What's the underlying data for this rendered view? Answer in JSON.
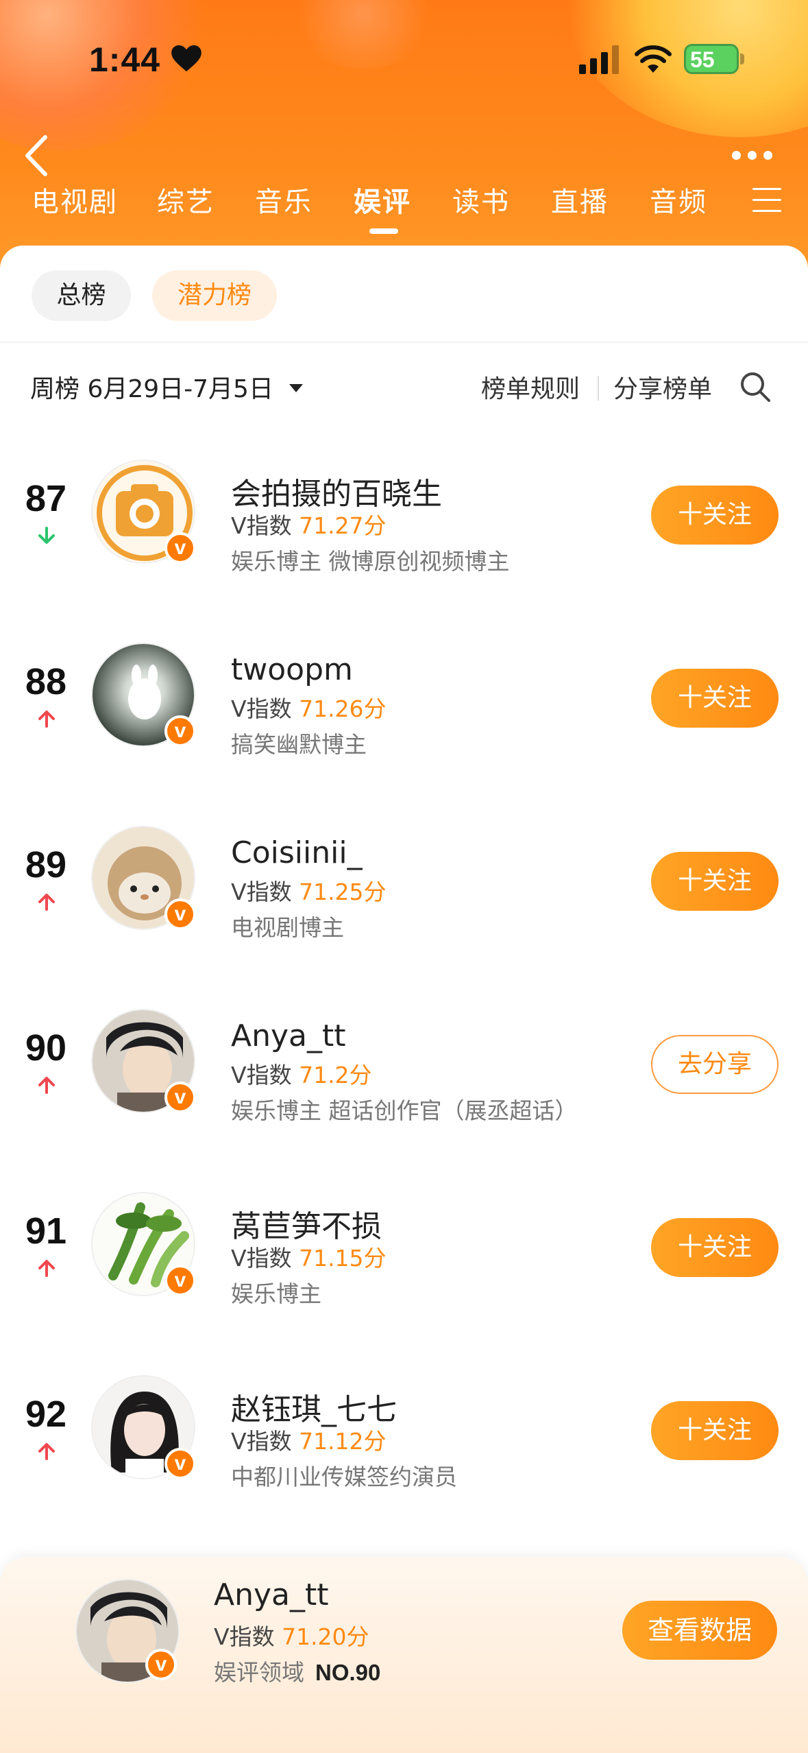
{
  "status_bar": {
    "time": "1:44",
    "battery": "55"
  },
  "nav": {
    "tabs": [
      {
        "label": "电视剧"
      },
      {
        "label": "综艺"
      },
      {
        "label": "音乐"
      },
      {
        "label": "娱评",
        "active": true
      },
      {
        "label": "读书"
      },
      {
        "label": "直播"
      },
      {
        "label": "音频"
      }
    ]
  },
  "sub_tabs": {
    "total": "总榜",
    "potential": "潜力榜"
  },
  "filter": {
    "week_label": "周榜 6月29日-7月5日",
    "rules": "榜单规则",
    "share_list": "分享榜单"
  },
  "rows": [
    {
      "rank": "87",
      "trend": "down",
      "name": "会拍摄的百晓生",
      "score_prefix": "V指数",
      "score": "71.27分",
      "desc": "娱乐博主 微博原创视频博主",
      "action": "十关注",
      "action_type": "follow"
    },
    {
      "rank": "88",
      "trend": "up",
      "name": "twoopm",
      "score_prefix": "V指数",
      "score": "71.26分",
      "desc": "搞笑幽默博主",
      "action": "十关注",
      "action_type": "follow"
    },
    {
      "rank": "89",
      "trend": "up",
      "name": "Coisiinii_",
      "score_prefix": "V指数",
      "score": "71.25分",
      "desc": "电视剧博主",
      "action": "十关注",
      "action_type": "follow"
    },
    {
      "rank": "90",
      "trend": "up",
      "name": "Anya_tt",
      "score_prefix": "V指数",
      "score": "71.2分",
      "desc": "娱乐博主 超话创作官（展丞超话）",
      "action": "去分享",
      "action_type": "share"
    },
    {
      "rank": "91",
      "trend": "up",
      "name": "莴苣笋不损",
      "score_prefix": "V指数",
      "score": "71.15分",
      "desc": "娱乐博主",
      "action": "十关注",
      "action_type": "follow"
    },
    {
      "rank": "92",
      "trend": "up",
      "name": "赵钰琪_七七",
      "score_prefix": "V指数",
      "score": "71.12分",
      "desc": "中都川业传媒签约演员",
      "action": "十关注",
      "action_type": "follow"
    }
  ],
  "me": {
    "name": "Anya_tt",
    "score_prefix": "V指数",
    "score": "71.20分",
    "domain_label": "娱评领域",
    "rank": "NO.90",
    "button": "查看数据"
  },
  "colors": {
    "accent": "#ff8a12",
    "up": "#f0474f",
    "down": "#2bc46c"
  }
}
